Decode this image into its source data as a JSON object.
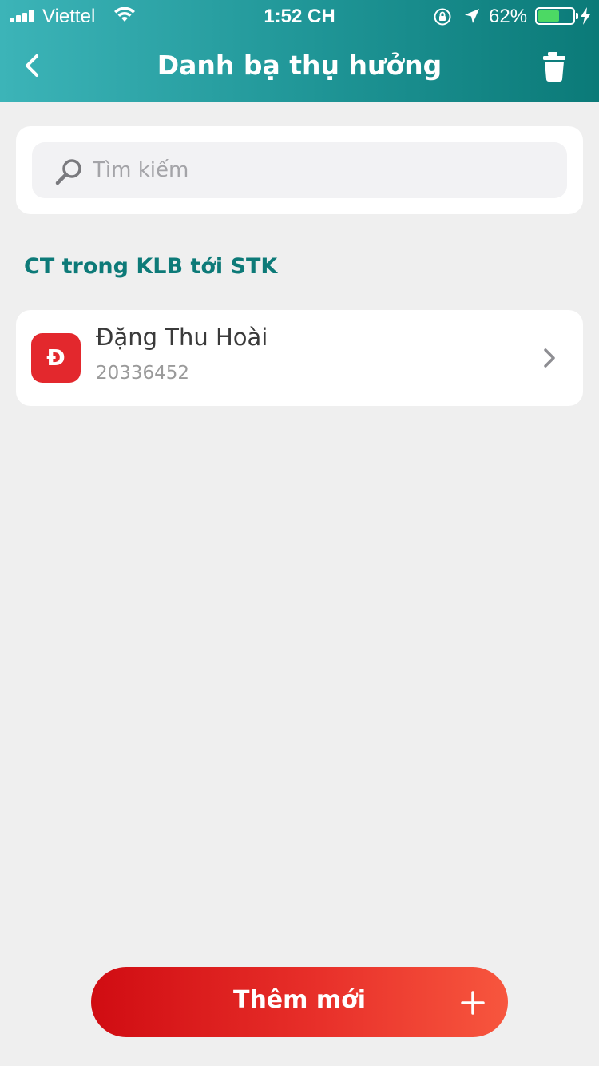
{
  "status_bar": {
    "carrier": "Viettel",
    "time": "1:52 CH",
    "battery_percent": "62%",
    "battery_level": 0.62
  },
  "header": {
    "title": "Danh bạ thụ hưởng",
    "background_colors": [
      "#3cb4b8",
      "#0b7a78"
    ]
  },
  "search": {
    "placeholder": "Tìm kiếm",
    "value": ""
  },
  "section": {
    "title": "CT trong KLB tới STK"
  },
  "contacts": [
    {
      "initial": "Đ",
      "name": "Đặng Thu Hoài",
      "account": "20336452",
      "avatar_color": "#e3282d"
    }
  ],
  "add_button": {
    "label": "Thêm mới",
    "colors": [
      "#d00c12",
      "#f7563e"
    ]
  }
}
